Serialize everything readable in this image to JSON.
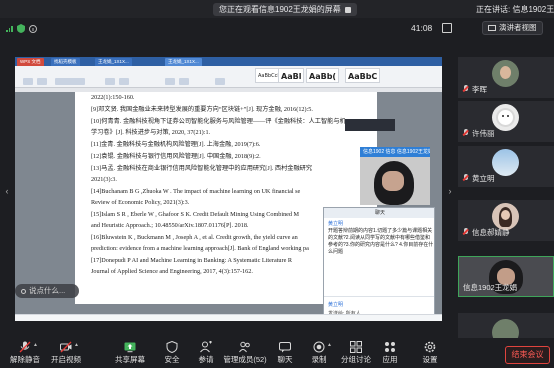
{
  "top_bar": {
    "sharing_notice": "您正在观看信息1902王龙娟的屏幕",
    "sharing_notice_right": "正在讲话: 信息1902王龙娟;"
  },
  "status_bar": {
    "duration": "41:08",
    "layout_button": "演讲者视图"
  },
  "shared_screen": {
    "app_tabs": [
      "WPS 文档",
      "找稻壳模板",
      "王龙娟_1X1X...",
      "王龙娟_1X1X..."
    ],
    "ribbon_styles": [
      "AaBbCcDd",
      "AaBl",
      "AaBb(",
      "AaBbC"
    ],
    "references": [
      "2022(1):150-160.",
      "[9]邓文贤. 我国金融业未来转型发展的重要方向“区块链+”[J]. 现方金融, 2016(12):5.",
      "[10]何青青. 金融科技视角下证券公司智能化服务与风险管理——评《金融科技：人工智能与机",
      "学习卷》[J]. 科技进步与对策, 2020, 37(21):1.",
      "[11]金青. 金融科技与金融机构风险管理[J]. 上海金融, 2019(7):6.",
      "[12]袁锟. 金融科技与银行信用风险管理[J]. 中国金融, 2018(9):2.",
      "[13]马孟. 金融科技在商业银行信用风险智能化管理中的应用研究[J]. 西村金融研究",
      "2021(3):3.",
      "[14]Buchanam B G ,Zhuoka W . The impact of machine learning on UK financial se",
      "Review of Economic Policy, 2021(3):3.",
      "[15]Islam S R ,  Eberle W ,  Ghafoor S K. Credit Default Mining Using Combined M",
      "and Heuristic Approach.; 10.48550/arXiv.1807.01176[P]. 2018.",
      "[16]Bluwstein K ,  Buckmann M ,  Joseph A , et al. Credit growth, the yield curve an",
      "prediction: evidence from a machine learning approach[J]. Bank of England working pa",
      "[17]Donepudi P   AI and Machine Learning in Banking: A Systematic Literature R",
      "Journal of Applied Science and Engineering, 2017, 4(3):157-162."
    ],
    "webcam_title": "信息1902 信息 信息1902王龙娟",
    "qq_window": {
      "title": "聊天",
      "contact": "黄立明",
      "message": "开题答辩前期的内容1.切题了多少篇与课题相关的文献?2.阅读从同学写的文献中有哪些借鉴和参考的?3.你的研究内容是什么? 4.你目前存在什么问题",
      "sender": "黄立明",
      "recipient_label": "发送给: 所有人"
    }
  },
  "chat_input": {
    "placeholder": "说点什么..."
  },
  "participants": [
    {
      "name": "李晖",
      "avatar": "photo"
    },
    {
      "name": "许伟丽",
      "avatar": "dog-photo"
    },
    {
      "name": "黄立明",
      "avatar": "sky-photo"
    },
    {
      "name": "信息郝婧静",
      "avatar": "portrait"
    },
    {
      "name": "信息1902王龙娟",
      "avatar": "video"
    },
    {
      "name": "李晖",
      "avatar": "partial"
    }
  ],
  "toolbar": {
    "buttons": [
      {
        "label": "解除静音",
        "icon": "mic-muted-icon"
      },
      {
        "label": "开启视频",
        "icon": "video-off-icon"
      },
      {
        "label": "共享屏幕",
        "icon": "share-screen-icon"
      },
      {
        "label": "安全",
        "icon": "shield-icon"
      },
      {
        "label": "参请",
        "icon": "invite-icon"
      },
      {
        "label": "管理成员(52)",
        "icon": "members-icon"
      },
      {
        "label": "聊天",
        "icon": "chat-icon"
      },
      {
        "label": "录制",
        "icon": "record-icon"
      },
      {
        "label": "分组讨论",
        "icon": "breakout-icon"
      },
      {
        "label": "应用",
        "icon": "apps-icon"
      },
      {
        "label": "设置",
        "icon": "settings-icon"
      }
    ],
    "end_meeting": "结束会议"
  }
}
